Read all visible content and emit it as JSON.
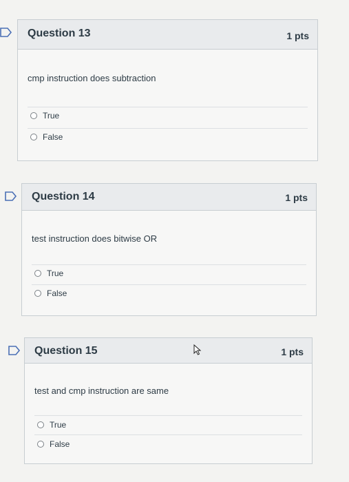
{
  "questions": [
    {
      "title": "Question 13",
      "points": "1 pts",
      "text": "cmp instruction does subtraction",
      "answers": [
        "True",
        "False"
      ]
    },
    {
      "title": "Question 14",
      "points": "1 pts",
      "text": "test instruction does bitwise OR",
      "answers": [
        "True",
        "False"
      ]
    },
    {
      "title": "Question 15",
      "points": "1 pts",
      "text": "test and cmp instruction are same",
      "answers": [
        "True",
        "False"
      ]
    }
  ],
  "colors": {
    "flag": "#4a6fb5",
    "header": "#e9ebed",
    "border": "#c7cdd1"
  },
  "icons": [
    "flag-icon",
    "radio-icon",
    "mouse-cursor-icon"
  ]
}
